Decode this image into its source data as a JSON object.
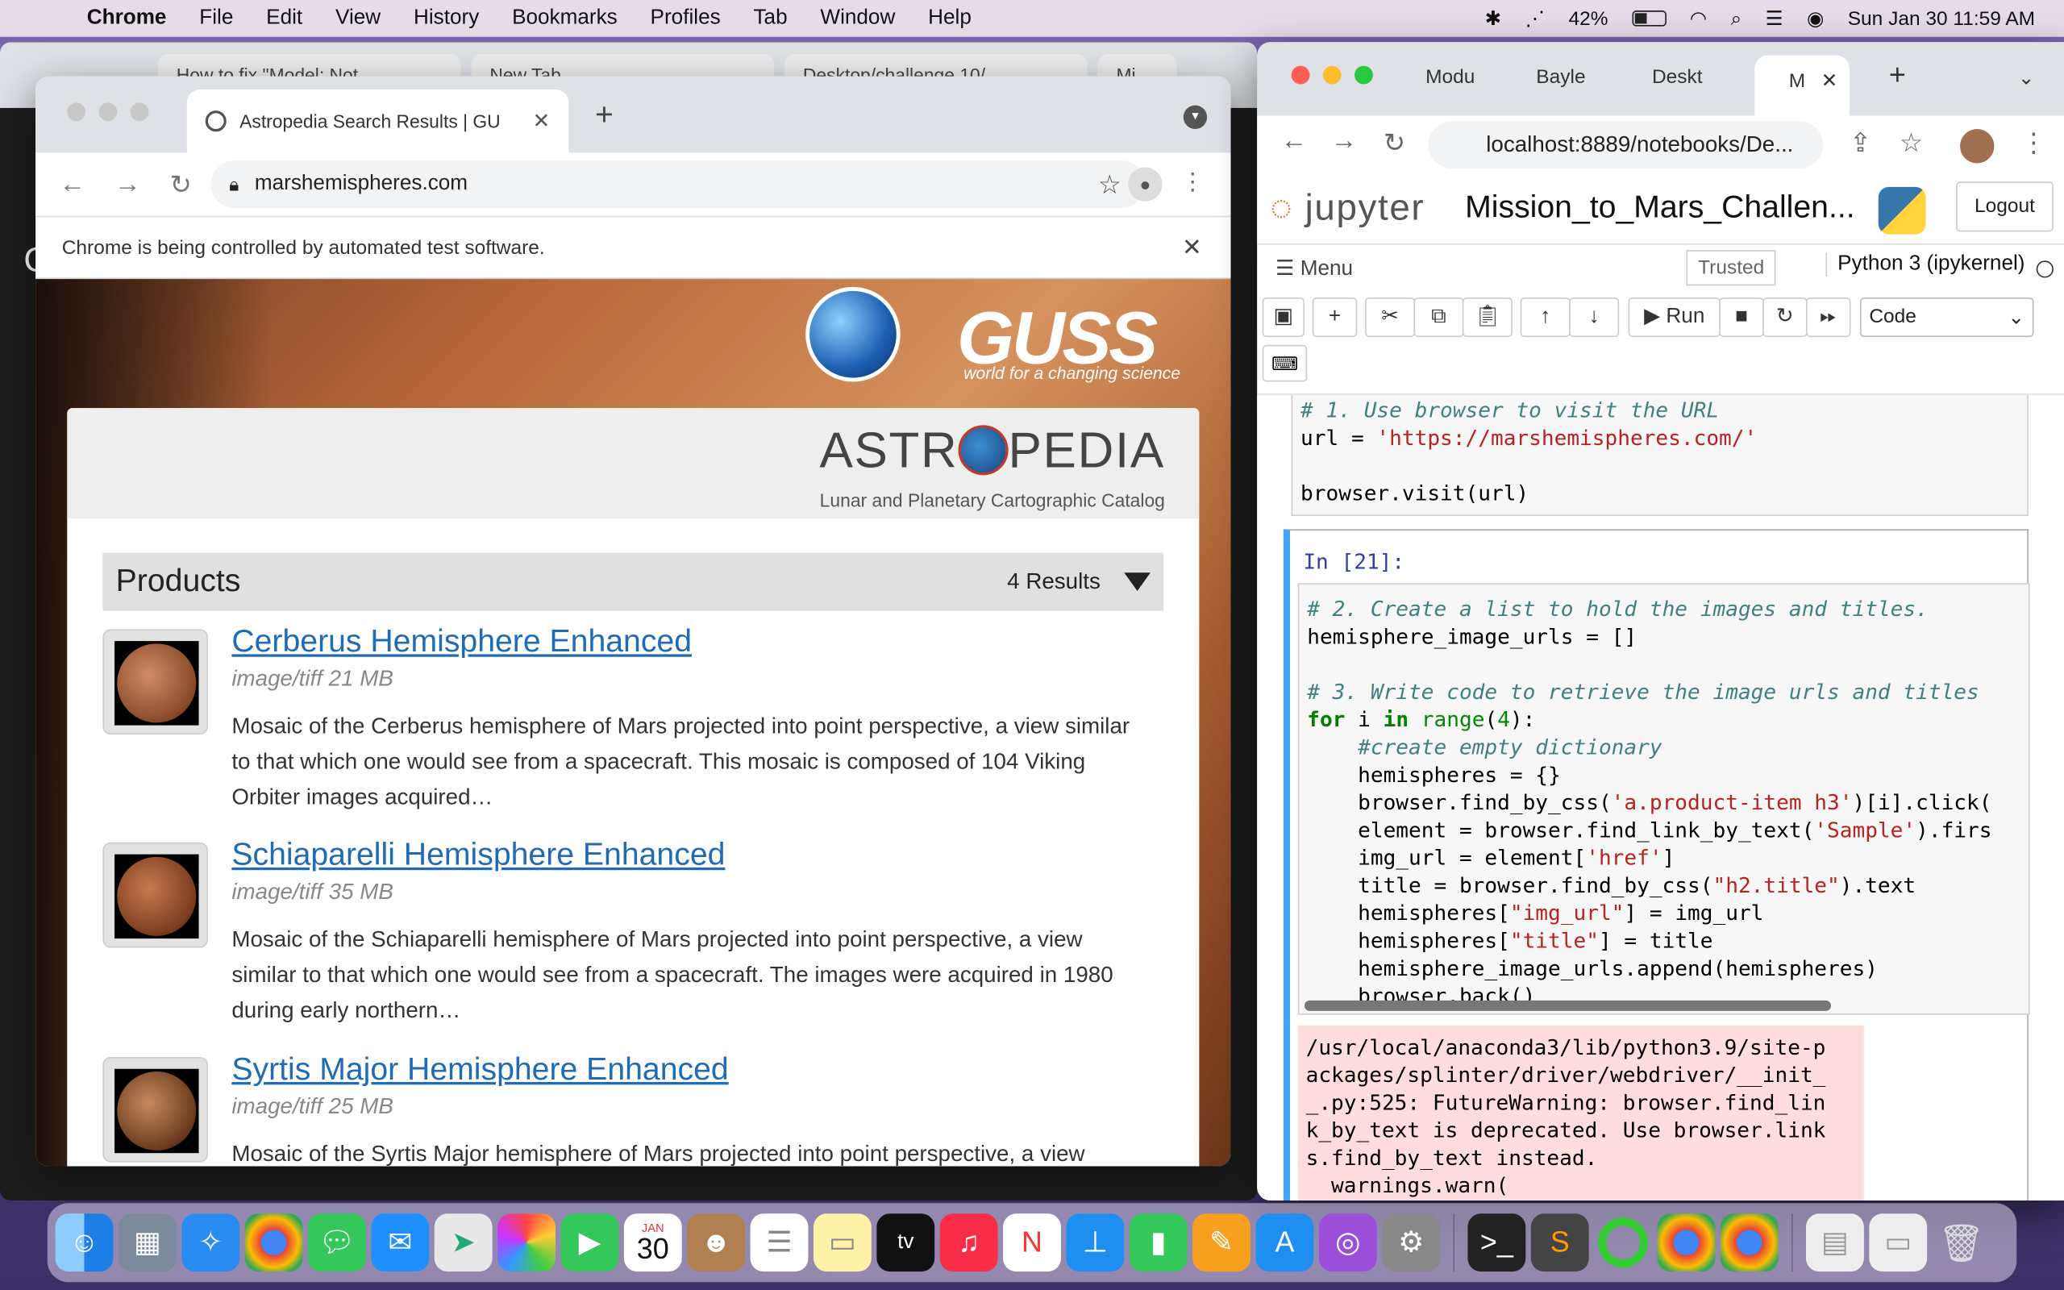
{
  "menubar": {
    "apple": "",
    "app_name": "Chrome",
    "items": [
      "File",
      "Edit",
      "View",
      "History",
      "Bookmarks",
      "Profiles",
      "Tab",
      "Window",
      "Help"
    ],
    "battery": "42%",
    "datetime": "Sun Jan 30  11:59 AM"
  },
  "bg_window": {
    "tabs": [
      "How to fix \"Model: Not...",
      "New Tab",
      "Desktop/challenge 10/...",
      "Mi"
    ],
    "left_text": "C"
  },
  "browser": {
    "tab_title": "Astropedia Search Results | GU",
    "url": "marshemispheres.com",
    "infobar": "Chrome is being controlled by automated test software.",
    "usgs_text": "GUSS",
    "usgs_tagline": "world for a changing science",
    "astropedia_left": "ASTR",
    "astropedia_right": "PEDIA",
    "astropedia_sub": "Lunar and Planetary Cartographic Catalog",
    "products_title": "Products",
    "results_count": "4 Results",
    "items": [
      {
        "title": "Cerberus Hemisphere Enhanced",
        "meta": "image/tiff 21 MB",
        "desc": "Mosaic of the Cerberus hemisphere of Mars projected into point perspective, a view similar to that which one would see from a spacecraft. This mosaic is composed of 104 Viking Orbiter images acquired…"
      },
      {
        "title": "Schiaparelli Hemisphere Enhanced",
        "meta": "image/tiff 35 MB",
        "desc": "Mosaic of the Schiaparelli hemisphere of Mars projected into point perspective, a view similar to that which one would see from a spacecraft. The images were acquired in 1980 during early northern…"
      },
      {
        "title": "Syrtis Major Hemisphere Enhanced",
        "meta": "image/tiff 25 MB",
        "desc": "Mosaic of the Syrtis Major hemisphere of Mars projected into point perspective, a view"
      }
    ]
  },
  "jupyter_window": {
    "tabs": [
      "Modu",
      "Bayle",
      "Deskt",
      "M"
    ],
    "url": "localhost:8889/notebooks/De...",
    "logo_text": "jupyter",
    "notebook_title": "Mission_to_Mars_Challen...",
    "logout": "Logout",
    "menu": "Menu",
    "trusted": "Trusted",
    "kernel": "Python 3 (ipykernel)",
    "run_label": "Run",
    "cell_type": "Code",
    "prompt": "In [21]:",
    "stderr": "/usr/local/anaconda3/lib/python3.9/site-p\nackages/splinter/driver/webdriver/__init_\n_.py:525: FutureWarning: browser.find_lin\nk_by_text is deprecated. Use browser.link\ns.find_by_text instead.\n  warnings.warn("
  },
  "dock": {
    "calendar_month": "JAN",
    "calendar_day": "30",
    "appletv_label": "tv"
  },
  "colors": {
    "link": "#1f6bb5",
    "jupyter_orange": "#f37726",
    "cell_selected": "#42a5f5",
    "stderr_bg": "#ffdddd"
  }
}
